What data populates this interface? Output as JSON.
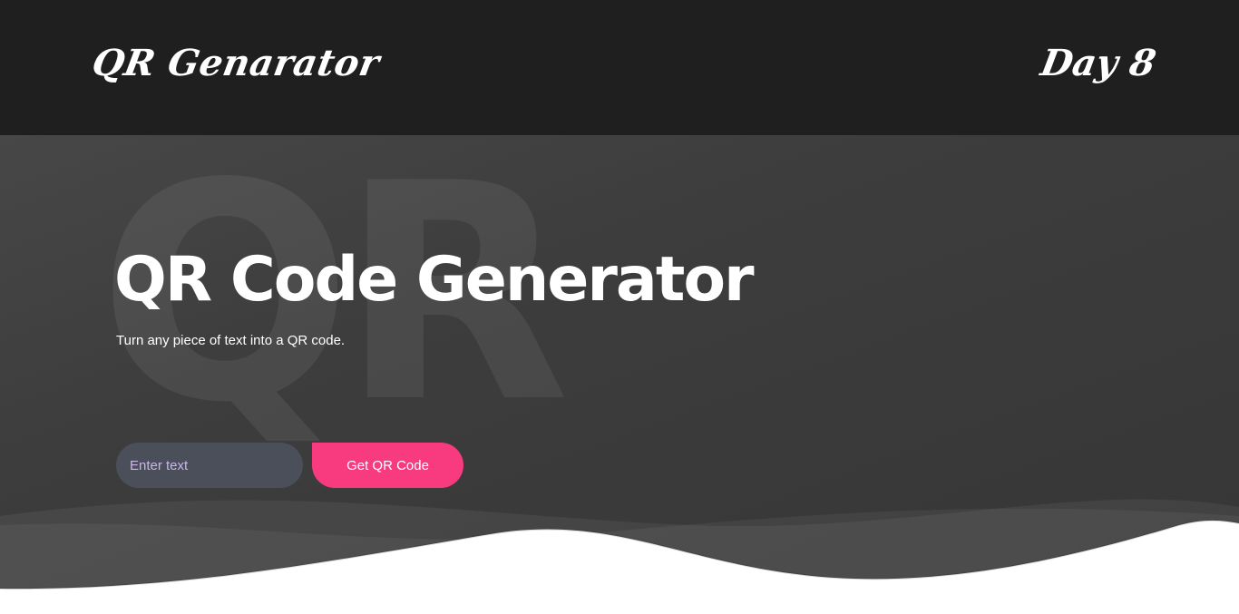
{
  "header": {
    "brand": "QR Genarator",
    "day_label": "Day 8"
  },
  "hero": {
    "background_text": "QR",
    "title": "QR Code Generator",
    "subtitle": "Turn any piece of text into a QR code."
  },
  "form": {
    "input_placeholder": "Enter text",
    "input_value": "",
    "button_label": "Get QR Code"
  },
  "colors": {
    "navbar": "#1f1f1f",
    "hero": "#3d3d3d",
    "accent": "#f73b7e",
    "input_bg": "#4a4f59",
    "placeholder": "#c9b6e8"
  }
}
